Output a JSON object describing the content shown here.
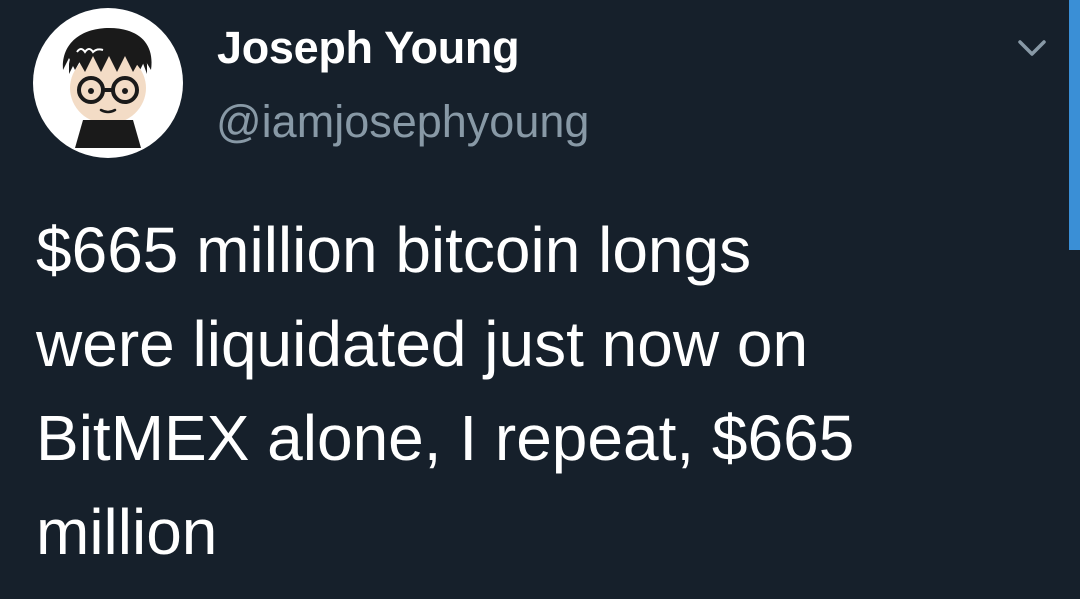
{
  "tweet": {
    "author": {
      "display_name": "Joseph Young",
      "handle": "@iamjosephyoung",
      "avatar_icon": "cartoon-avatar-with-glasses"
    },
    "menu_icon": "chevron-down-icon",
    "text_lines": [
      "$665 million bitcoin longs",
      "were liquidated just now on",
      "BitMEX alone, I repeat, $665",
      "million"
    ]
  },
  "colors": {
    "background": "#16202b",
    "text": "#ffffff",
    "secondary_text": "#8899a6",
    "accent": "#3a8fd6"
  }
}
